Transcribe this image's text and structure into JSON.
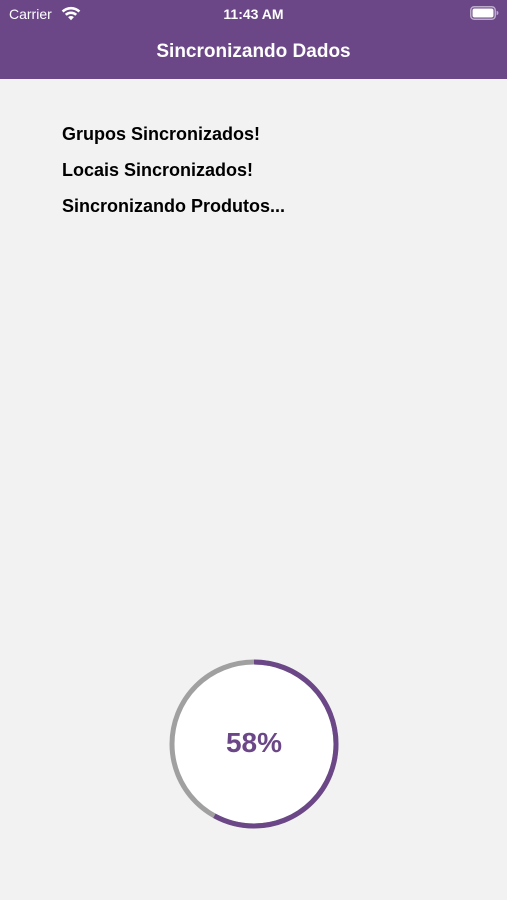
{
  "status_bar": {
    "carrier": "Carrier",
    "time": "11:43 AM"
  },
  "header": {
    "title": "Sincronizando Dados"
  },
  "sync_log": [
    "Grupos Sincronizados!",
    "Locais Sincronizados!",
    "Sincronizando Produtos..."
  ],
  "progress": {
    "label": "58%",
    "value": 0.58
  },
  "colors": {
    "accent": "#6b4787",
    "track": "#a0a0a0",
    "background": "#f2f2f2",
    "circle_fill": "#ffffff"
  },
  "icons": [
    "wifi-icon",
    "battery-icon"
  ]
}
